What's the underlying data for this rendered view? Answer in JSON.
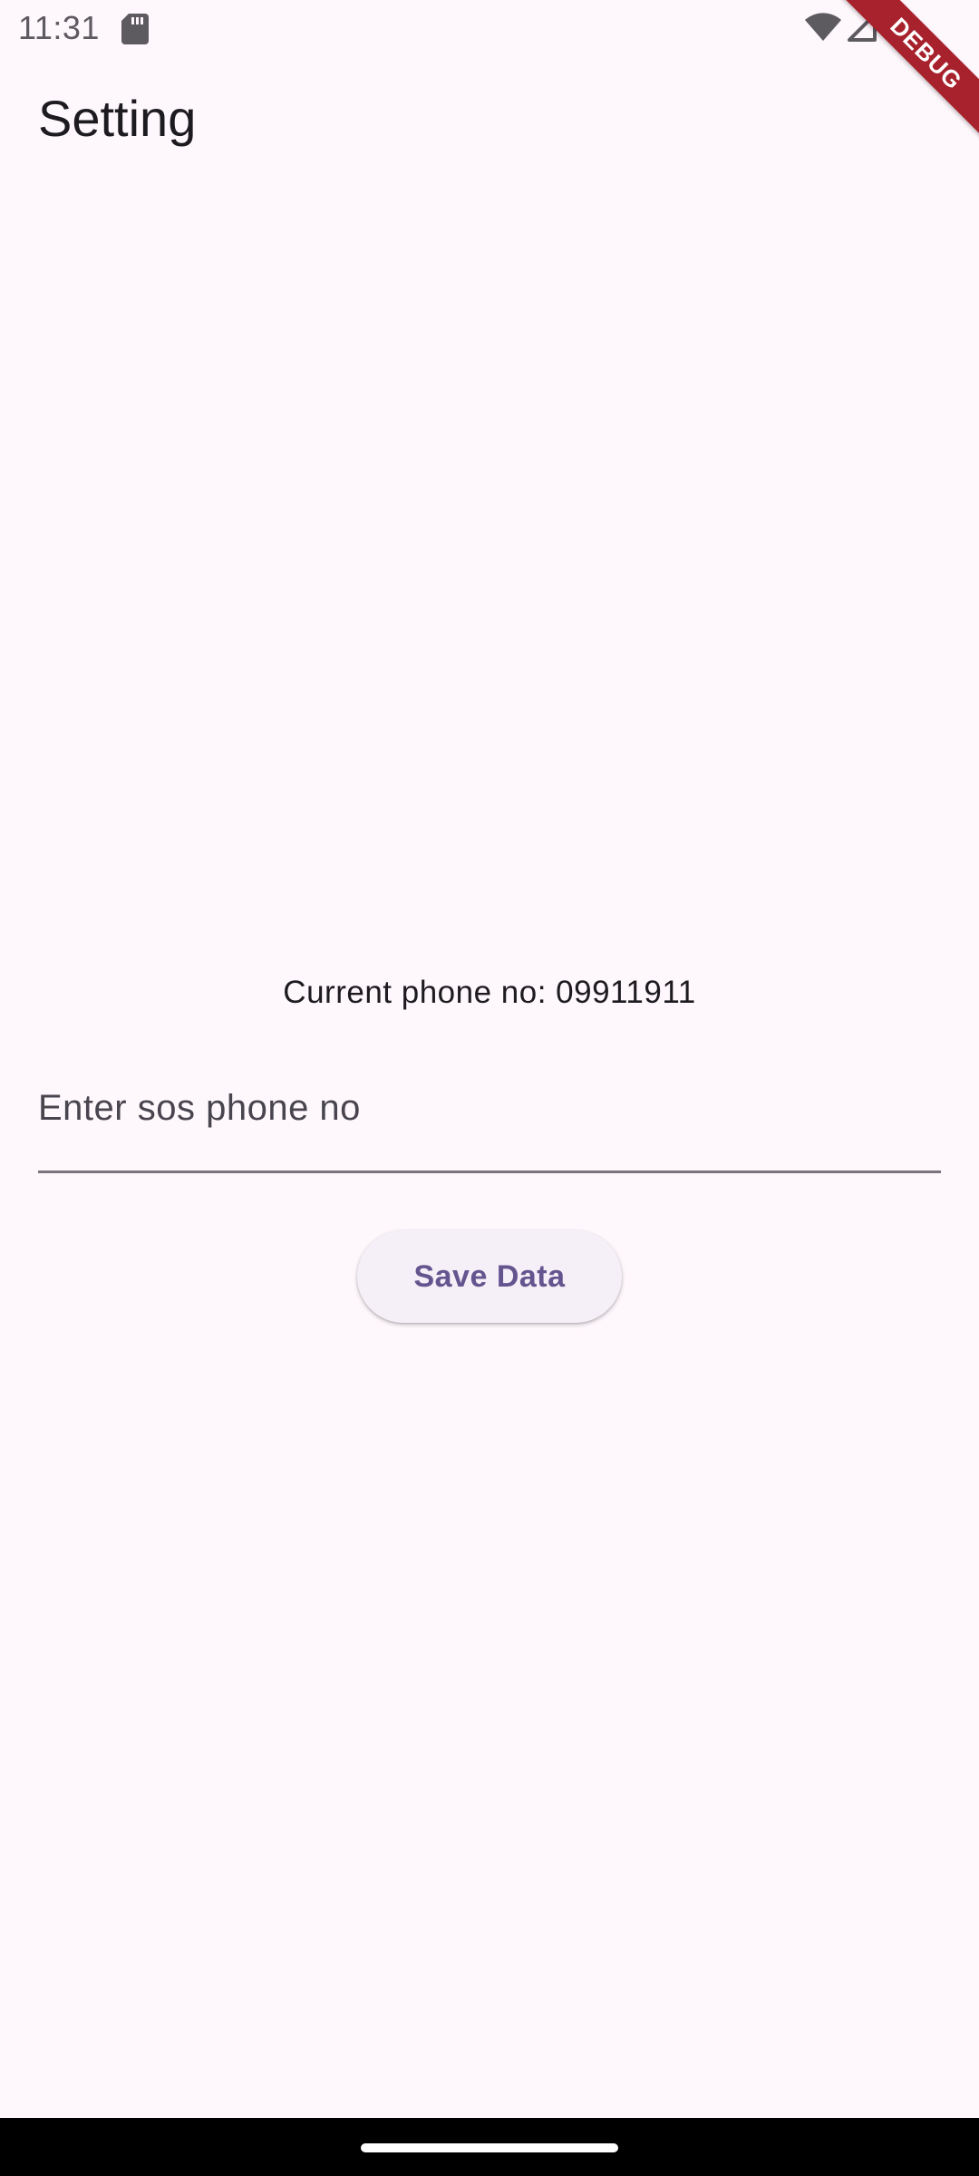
{
  "status_bar": {
    "time": "11:31",
    "icons": [
      "sd-card-icon",
      "wifi-icon",
      "signal-icon",
      "battery-icon"
    ]
  },
  "debug_banner": {
    "label": "DEBUG",
    "color": "#a8222d"
  },
  "app_bar": {
    "title": "Setting"
  },
  "main": {
    "current_phone_text": "Current phone no: 09911911",
    "phone_input": {
      "placeholder": "Enter sos phone no",
      "value": ""
    },
    "save_button_label": "Save Data"
  },
  "colors": {
    "background": "#fef7fc",
    "accent": "#65558f",
    "button_surface": "#f5eff7",
    "underline": "#79747e"
  }
}
